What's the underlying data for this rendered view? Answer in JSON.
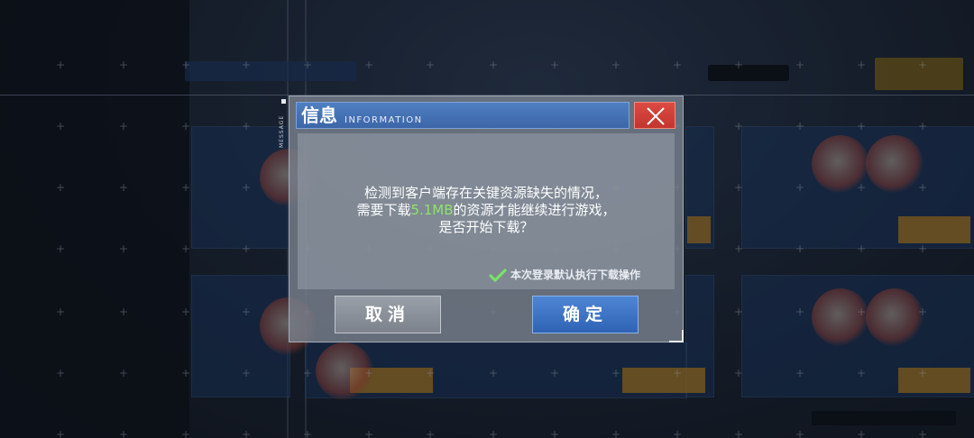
{
  "dialog": {
    "side_label": "MESSAGE",
    "title_cn": "信息",
    "title_en": "INFORMATION",
    "close_icon": "close-icon",
    "message": {
      "line1": "检测到客户端存在关键资源缺失的情况，",
      "line2_before": "需要下载",
      "line2_size": "5.1MB",
      "line2_after": "的资源才能继续进行游戏，",
      "line3": "是否开始下载？"
    },
    "checkbox": {
      "icon": "check-icon",
      "label": "本次登录默认执行下载操作",
      "checked": true
    },
    "buttons": {
      "cancel": "取消",
      "confirm": "确定"
    }
  },
  "colors": {
    "title_bar": "#4a78bc",
    "close_button": "#d0423a",
    "confirm_button": "#3c70c0",
    "cancel_button": "#8a9098",
    "highlight": "#8fe36b"
  }
}
